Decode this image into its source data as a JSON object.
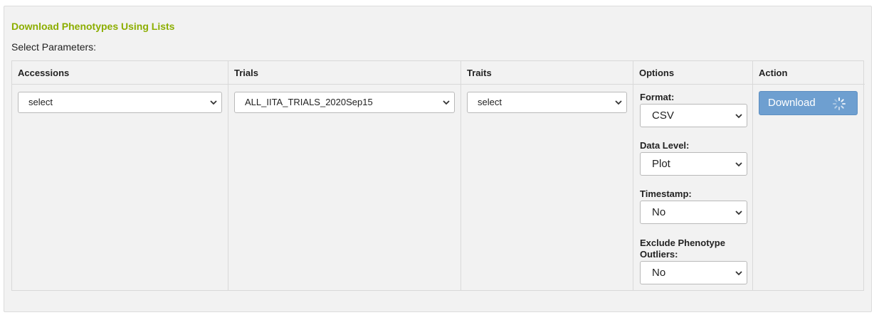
{
  "panel": {
    "title": "Download Phenotypes Using Lists",
    "subtitle": "Select Parameters:"
  },
  "columns": {
    "accessions": "Accessions",
    "trials": "Trials",
    "traits": "Traits",
    "options": "Options",
    "action": "Action"
  },
  "selects": {
    "accessions": "select",
    "trials": "ALL_IITA_TRIALS_2020Sep15",
    "traits": "select"
  },
  "options": {
    "format_label": "Format:",
    "format_value": "CSV",
    "data_level_label": "Data Level:",
    "data_level_value": "Plot",
    "timestamp_label": "Timestamp:",
    "timestamp_value": "No",
    "exclude_label_line1": "Exclude Phenotype",
    "exclude_label_line2": "Outliers:",
    "exclude_value": "No"
  },
  "action": {
    "download_label": "Download",
    "spinner_icon": "loading-spinner-icon"
  },
  "colors": {
    "title": "#8cae00",
    "button": "#6e9fd0"
  }
}
